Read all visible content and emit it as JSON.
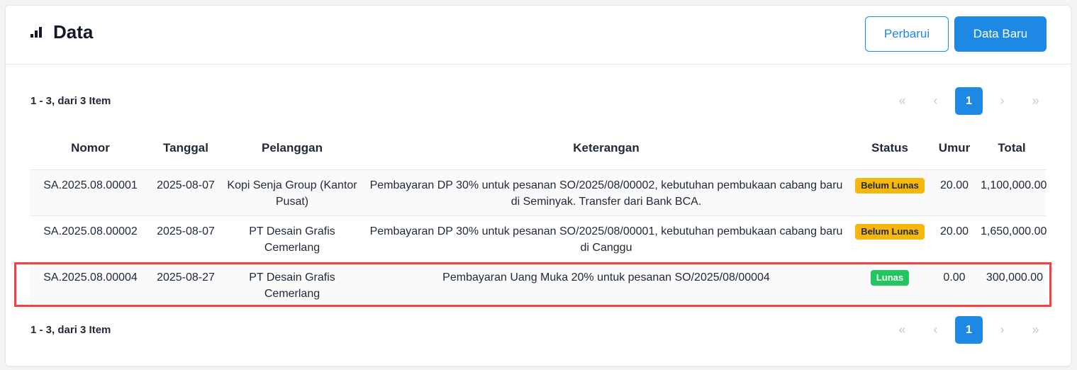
{
  "header": {
    "title": "Data",
    "icon": "bar-chart-icon",
    "refresh_label": "Perbarui",
    "new_label": "Data Baru"
  },
  "summary": "1 - 3, dari 3 Item",
  "pagination": {
    "first": "«",
    "prev": "‹",
    "current": "1",
    "next": "›",
    "last": "»"
  },
  "columns": [
    "Nomor",
    "Tanggal",
    "Pelanggan",
    "Keterangan",
    "Status",
    "Umur",
    "Total"
  ],
  "rows": [
    {
      "nomor": "SA.2025.08.00001",
      "tanggal": "2025-08-07",
      "pelanggan": "Kopi Senja Group (Kantor Pusat)",
      "keterangan": "Pembayaran DP 30% untuk pesanan SO/2025/08/00002, kebutuhan pembukaan cabang baru di Seminyak. Transfer dari Bank BCA.",
      "status": "Belum Lunas",
      "umur": "20.00",
      "total": "1,100,000.00"
    },
    {
      "nomor": "SA.2025.08.00002",
      "tanggal": "2025-08-07",
      "pelanggan": "PT Desain Grafis Cemerlang",
      "keterangan": "Pembayaran DP 30% untuk pesanan SO/2025/08/00001, kebutuhan pembukaan cabang baru di Canggu",
      "status": "Belum Lunas",
      "umur": "20.00",
      "total": "1,650,000.00"
    },
    {
      "nomor": "SA.2025.08.00004",
      "tanggal": "2025-08-27",
      "pelanggan": "PT Desain Grafis Cemerlang",
      "keterangan": "Pembayaran Uang Muka 20% untuk pesanan SO/2025/08/00004",
      "status": "Lunas",
      "umur": "0.00",
      "total": "300,000.00"
    }
  ],
  "colors": {
    "primary": "#1e88e5",
    "status_unpaid": "#f5b70b",
    "status_paid": "#22c55e",
    "highlight": "#ef4444"
  }
}
